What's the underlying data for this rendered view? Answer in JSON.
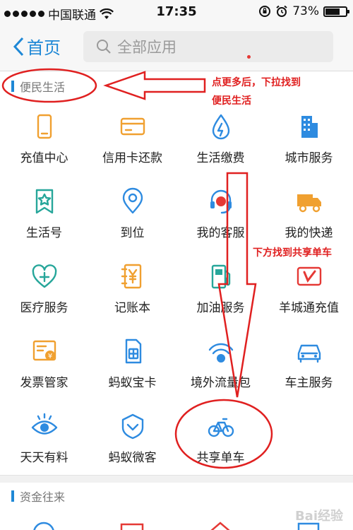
{
  "status_bar": {
    "carrier": "中国联通",
    "time": "17:35",
    "battery": "73%",
    "battery_level": 0.73
  },
  "nav": {
    "back_label": "首页",
    "search_placeholder": "全部应用"
  },
  "sections": {
    "first": "便民生活",
    "second": "资金往来"
  },
  "grid": [
    [
      {
        "label": "充值中心",
        "icon": "phone-icon",
        "color": "#f0a030"
      },
      {
        "label": "信用卡还款",
        "icon": "credit-card-icon",
        "color": "#f0a030"
      },
      {
        "label": "生活缴费",
        "icon": "utility-drop-icon",
        "color": "#2e8be0"
      },
      {
        "label": "城市服务",
        "icon": "city-building-icon",
        "color": "#2e8be0"
      }
    ],
    [
      {
        "label": "生活号",
        "icon": "bookmark-star-icon",
        "color": "#26a69a"
      },
      {
        "label": "到位",
        "icon": "location-pin-icon",
        "color": "#2e8be0"
      },
      {
        "label": "我的客服",
        "icon": "headset-icon",
        "color": "#2e8be0"
      },
      {
        "label": "我的快递",
        "icon": "delivery-truck-icon",
        "color": "#f0a030"
      }
    ],
    [
      {
        "label": "医疗服务",
        "icon": "medical-heart-icon",
        "color": "#26a69a"
      },
      {
        "label": "记账本",
        "icon": "ledger-yen-icon",
        "color": "#f0a030"
      },
      {
        "label": "加油服务",
        "icon": "fuel-pump-icon",
        "color": "#26a69a"
      },
      {
        "label": "羊城通充值",
        "icon": "yangchengtong-card-icon",
        "color": "#e53935"
      }
    ],
    [
      {
        "label": "发票管家",
        "icon": "invoice-icon",
        "color": "#f0a030"
      },
      {
        "label": "蚂蚁宝卡",
        "icon": "sim-card-icon",
        "color": "#2e8be0"
      },
      {
        "label": "境外流量包",
        "icon": "globe-wifi-icon",
        "color": "#2e8be0"
      },
      {
        "label": "车主服务",
        "icon": "car-icon",
        "color": "#2e8be0"
      }
    ],
    [
      {
        "label": "天天有料",
        "icon": "eye-target-icon",
        "color": "#2e8be0"
      },
      {
        "label": "蚂蚁微客",
        "icon": "ant-shield-icon",
        "color": "#2e8be0"
      },
      {
        "label": "共享单车",
        "icon": "bicycle-icon",
        "color": "#2e8be0"
      }
    ]
  ],
  "annotations": {
    "note1_line1": "点更多后，下拉找到",
    "note1_line2": "便民生活",
    "note2": "下方找到共享单车",
    "color": "#e02020"
  },
  "watermark": "Bai经验"
}
